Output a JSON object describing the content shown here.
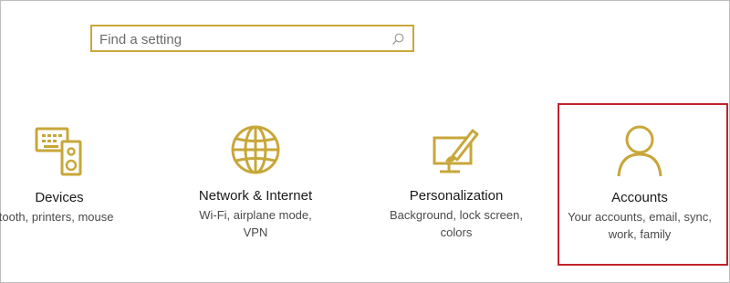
{
  "search": {
    "placeholder": "Find a setting"
  },
  "accent_color": "#c8a73a",
  "highlight_color": "#c2222b",
  "tiles": [
    {
      "icon": "devices-icon",
      "title": "Devices",
      "subtitle": "etooth, printers, mouse"
    },
    {
      "icon": "globe-icon",
      "title": "Network & Internet",
      "subtitle": "Wi-Fi, airplane mode, VPN"
    },
    {
      "icon": "personalization-icon",
      "title": "Personalization",
      "subtitle_line1": "Background, lock screen,",
      "subtitle_line2": "colors"
    },
    {
      "icon": "person-icon",
      "title": "Accounts",
      "subtitle_line1": "Your accounts, email, sync,",
      "subtitle_line2": "work, family"
    }
  ]
}
